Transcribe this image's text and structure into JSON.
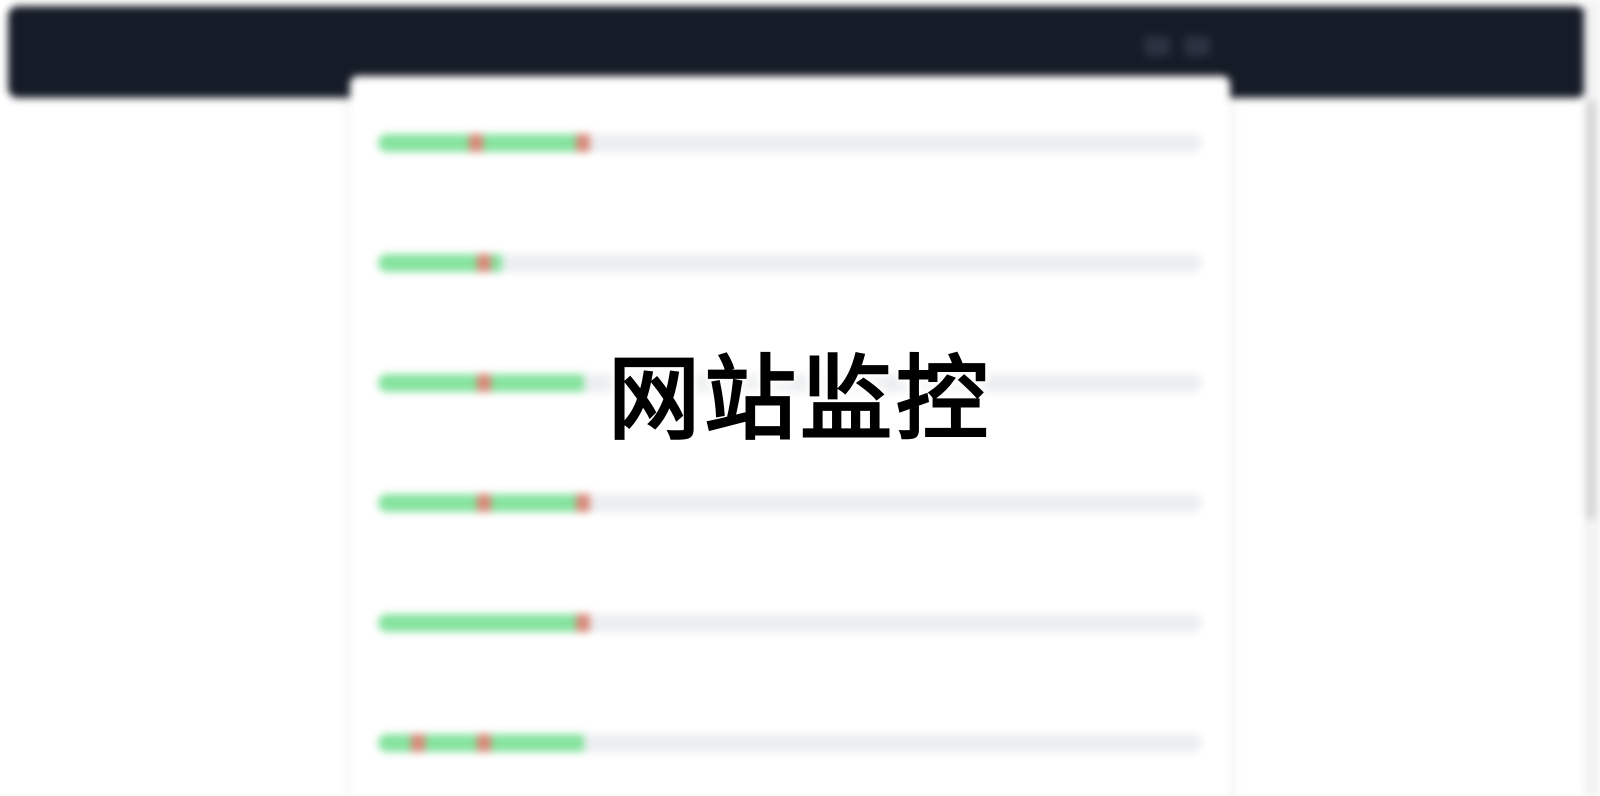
{
  "header": {
    "brand": "",
    "buttons": [
      "",
      ""
    ]
  },
  "monitors": [
    {
      "name": "",
      "uptime": "",
      "left": "",
      "msg": "",
      "right": "",
      "fill_fraction": 0.25,
      "down_positions": [
        0.11,
        0.24
      ]
    },
    {
      "name": "",
      "uptime": "",
      "left": "",
      "msg": "",
      "right": "",
      "fill_fraction": 0.15,
      "down_positions": [
        0.12
      ]
    },
    {
      "name": "",
      "uptime": "",
      "left": "",
      "msg": "",
      "right": "",
      "fill_fraction": 0.25,
      "down_positions": [
        0.12
      ]
    },
    {
      "name": "",
      "uptime": "",
      "left": "",
      "msg": "",
      "right": "",
      "fill_fraction": 0.25,
      "down_positions": [
        0.12,
        0.24
      ]
    },
    {
      "name": "",
      "uptime": "",
      "left": "",
      "msg": "",
      "right": "",
      "fill_fraction": 0.25,
      "down_positions": [
        0.24
      ]
    },
    {
      "name": "",
      "uptime": "",
      "left": "",
      "msg": "",
      "right": "",
      "fill_fraction": 0.25,
      "down_positions": [
        0.04,
        0.12
      ]
    }
  ],
  "overlay": {
    "title": "网站监控"
  },
  "colors": {
    "header_bg": "#161c27",
    "brand": "#3fcf6e",
    "up": "#86e39f",
    "down": "#d98a7a",
    "track": "#eceef0"
  }
}
